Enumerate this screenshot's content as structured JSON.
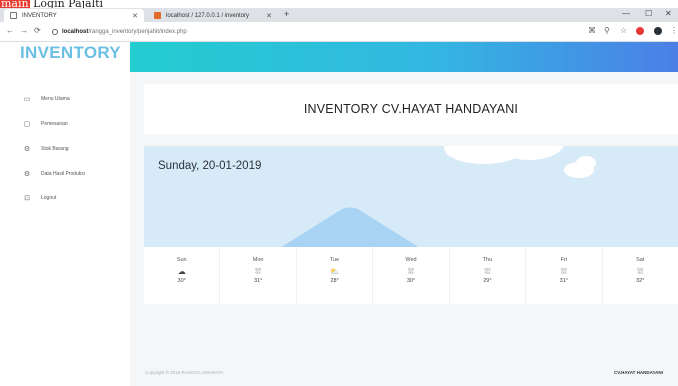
{
  "top_label": {
    "highlight": "main",
    "text": "Login Pajalti"
  },
  "browser": {
    "tabs": [
      {
        "title": "INVENTORY",
        "icon": "page-icon"
      },
      {
        "title": "localhost / 127.0.0.1 / inventory",
        "icon": "database-icon"
      }
    ],
    "url_host": "localhost",
    "url_path": "/rangga_inventory/penjahit/index.php"
  },
  "app": {
    "brand": "INVENTORY",
    "nav": [
      {
        "label": "Menu Utama",
        "icon": "monitor-icon"
      },
      {
        "label": "Pemesanan",
        "icon": "box-icon"
      },
      {
        "label": "Stok Barang",
        "icon": "gear-icon"
      },
      {
        "label": "Data Hasil Produksi",
        "icon": "gear-icon"
      },
      {
        "label": "Logout",
        "icon": "logout-icon"
      }
    ],
    "header_title": "INVENTORY CV.HAYAT HANDAYANI",
    "weather": {
      "date": "Sunday, 20-01-2019",
      "forecast": [
        {
          "day": "Sun",
          "temp": "30°",
          "icon": "cloud-icon"
        },
        {
          "day": "Mon",
          "temp": "31°",
          "icon": "cloud-rain-icon"
        },
        {
          "day": "Tue",
          "temp": "28°",
          "icon": "cloud-sun-icon"
        },
        {
          "day": "Wed",
          "temp": "30°",
          "icon": "cloud-rain-icon"
        },
        {
          "day": "Thu",
          "temp": "29°",
          "icon": "cloud-rain-icon"
        },
        {
          "day": "Fri",
          "temp": "31°",
          "icon": "cloud-rain-icon"
        },
        {
          "day": "Sat",
          "temp": "32°",
          "icon": "cloud-rain-icon"
        }
      ]
    },
    "footer_left": "Copyright © 2018 RANGGA SWARAYA",
    "footer_right": "CV.HAYAT HANDAYANI"
  },
  "colors": {
    "brand": "#6bbfe2",
    "gradient_start": "#23cdd0",
    "gradient_end": "#4b7fe6"
  }
}
